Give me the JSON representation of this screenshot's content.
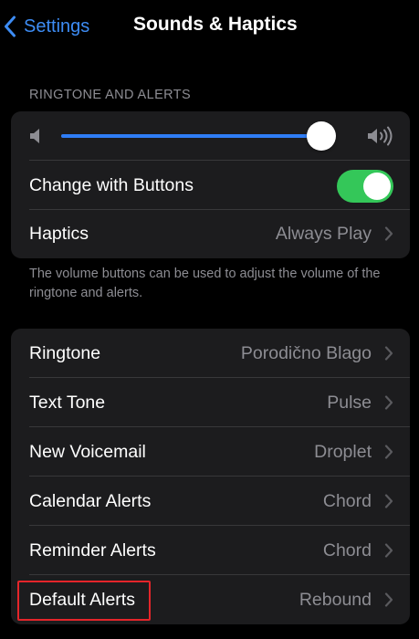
{
  "nav": {
    "back_label": "Settings",
    "title": "Sounds & Haptics"
  },
  "ringtone_section": {
    "header": "RINGTONE AND ALERTS",
    "volume": {
      "level": 0.95,
      "low_icon": "speaker-low-icon",
      "high_icon": "speaker-high-icon"
    },
    "change_with_buttons": {
      "label": "Change with Buttons",
      "enabled": true
    },
    "haptics": {
      "label": "Haptics",
      "value": "Always Play"
    },
    "footer": "The volume buttons can be used to adjust the volume of the ringtone and alerts."
  },
  "sound_rows": [
    {
      "label": "Ringtone",
      "value": "Porodično Blago"
    },
    {
      "label": "Text Tone",
      "value": "Pulse"
    },
    {
      "label": "New Voicemail",
      "value": "Droplet"
    },
    {
      "label": "Calendar Alerts",
      "value": "Chord"
    },
    {
      "label": "Reminder Alerts",
      "value": "Chord"
    },
    {
      "label": "Default Alerts",
      "value": "Rebound"
    }
  ],
  "colors": {
    "background": "#000000",
    "cell": "#1c1c1e",
    "accent": "#3d8cf4",
    "slider": "#2f7df6",
    "toggle_on": "#34c759",
    "secondary_text": "#8d8d93",
    "highlight": "#e5252a"
  },
  "highlighted_row": "Default Alerts"
}
